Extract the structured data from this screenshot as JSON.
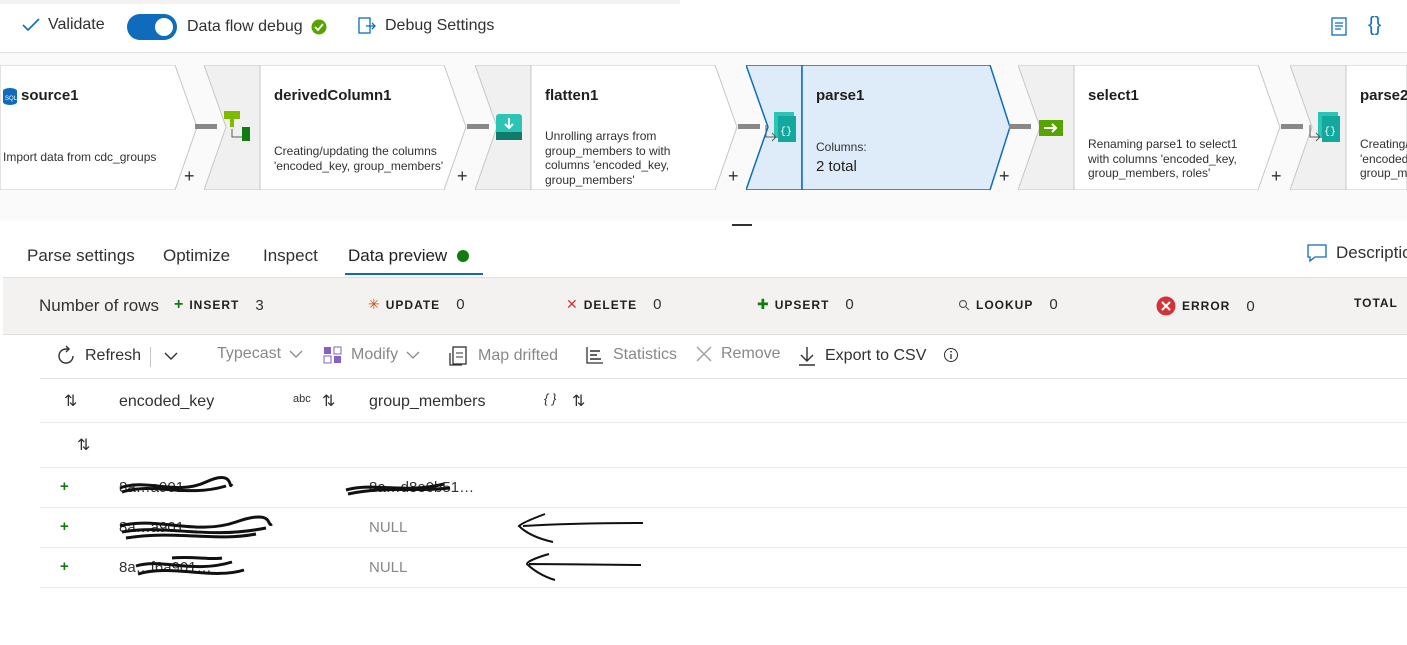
{
  "toolbar": {
    "validate": "Validate",
    "debug_label": "Data flow debug",
    "debug_settings": "Debug Settings",
    "debug_on": true
  },
  "pipeline": {
    "nodes": [
      {
        "name": "source1",
        "desc": [
          "Import data from cdc_groups"
        ]
      },
      {
        "name": "derivedColumn1",
        "desc": [
          "Creating/updating the columns",
          "'encoded_key, group_members'"
        ]
      },
      {
        "name": "flatten1",
        "desc": [
          "Unrolling arrays from",
          "group_members to  with",
          "columns 'encoded_key,",
          "group_members'"
        ]
      },
      {
        "name": "parse1",
        "desc": [
          "Columns:"
        ],
        "extra": "2 total"
      },
      {
        "name": "select1",
        "desc": [
          "Renaming parse1 to select1",
          "with columns 'encoded_key,",
          "group_members, roles'"
        ]
      },
      {
        "name": "parse2",
        "desc": [
          "Creating/",
          "'encoded",
          "group_m"
        ]
      }
    ],
    "plus": "+"
  },
  "tabs": {
    "parse_settings": "Parse settings",
    "optimize": "Optimize",
    "inspect": "Inspect",
    "data_preview": "Data preview",
    "description": "Descriptio"
  },
  "stats": {
    "rows_label": "Number of rows",
    "insert": {
      "label": "INSERT",
      "value": "3"
    },
    "update": {
      "label": "UPDATE",
      "value": "0"
    },
    "delete": {
      "label": "DELETE",
      "value": "0"
    },
    "upsert": {
      "label": "UPSERT",
      "value": "0"
    },
    "lookup": {
      "label": "LOOKUP",
      "value": "0"
    },
    "error": {
      "label": "ERROR",
      "value": "0"
    },
    "total": {
      "label": "TOTAL"
    }
  },
  "actions": {
    "refresh": "Refresh",
    "typecast": "Typecast",
    "modify": "Modify",
    "map_drifted": "Map drifted",
    "statistics": "Statistics",
    "remove": "Remove",
    "export_csv": "Export to CSV"
  },
  "grid": {
    "columns": [
      {
        "name": "encoded_key",
        "type": "abc"
      },
      {
        "name": "group_members",
        "type": "{ }"
      }
    ],
    "rows": [
      {
        "flag": "+",
        "encoded_key": "8a…a901…",
        "group_members": "8a…d8e0b51…"
      },
      {
        "flag": "+",
        "encoded_key": "8a…a901…",
        "group_members": "NULL"
      },
      {
        "flag": "+",
        "encoded_key": "8a…f6a901…",
        "group_members": "NULL"
      }
    ]
  },
  "colors": {
    "accent": "#0f6cbd",
    "success": "#107c10",
    "error": "#d13438",
    "node_selected": "#deecf9"
  }
}
